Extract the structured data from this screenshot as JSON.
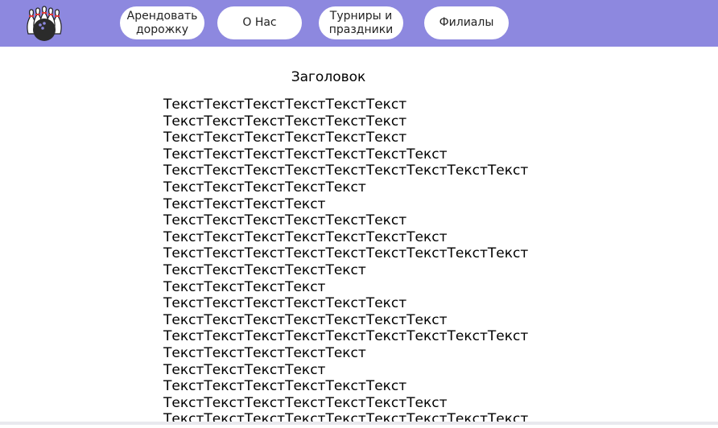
{
  "header": {
    "background": "#8d88df",
    "logo_icon": "bowling-pins-and-ball-icon",
    "nav": [
      {
        "label": "Арендовать\nдорожку"
      },
      {
        "label": "О Нас"
      },
      {
        "label": "Турниры и\nпраздники"
      },
      {
        "label": "Филиалы"
      }
    ]
  },
  "main": {
    "title": "Заголовок",
    "lines": [
      "ТекстТекстТекстТекстТекстТекст",
      "ТекстТекстТекстТекстТекстТекст",
      "ТекстТекстТекстТекстТекстТекст",
      "ТекстТекстТекстТекстТекстТекстТекст",
      "ТекстТекстТекстТекстТекстТекстТекстТекстТекст",
      "ТекстТекстТекстТекстТекст",
      "ТекстТекстТекстТекст",
      "ТекстТекстТекстТекстТекстТекст",
      "ТекстТекстТекстТекстТекстТекстТекст",
      "ТекстТекстТекстТекстТекстТекстТекстТекстТекст",
      "ТекстТекстТекстТекстТекст",
      "ТекстТекстТекстТекст",
      "ТекстТекстТекстТекстТекстТекст",
      "ТекстТекстТекстТекстТекстТекстТекст",
      "ТекстТекстТекстТекстТекстТекстТекстТекстТекст",
      "ТекстТекстТекстТекстТекст",
      "ТекстТекстТекстТекст",
      "ТекстТекстТекстТекстТекстТекст",
      "ТекстТекстТекстТекстТекстТекстТекст",
      "ТекстТекстТекстТекстТекстТекстТекстТекстТекст"
    ]
  }
}
